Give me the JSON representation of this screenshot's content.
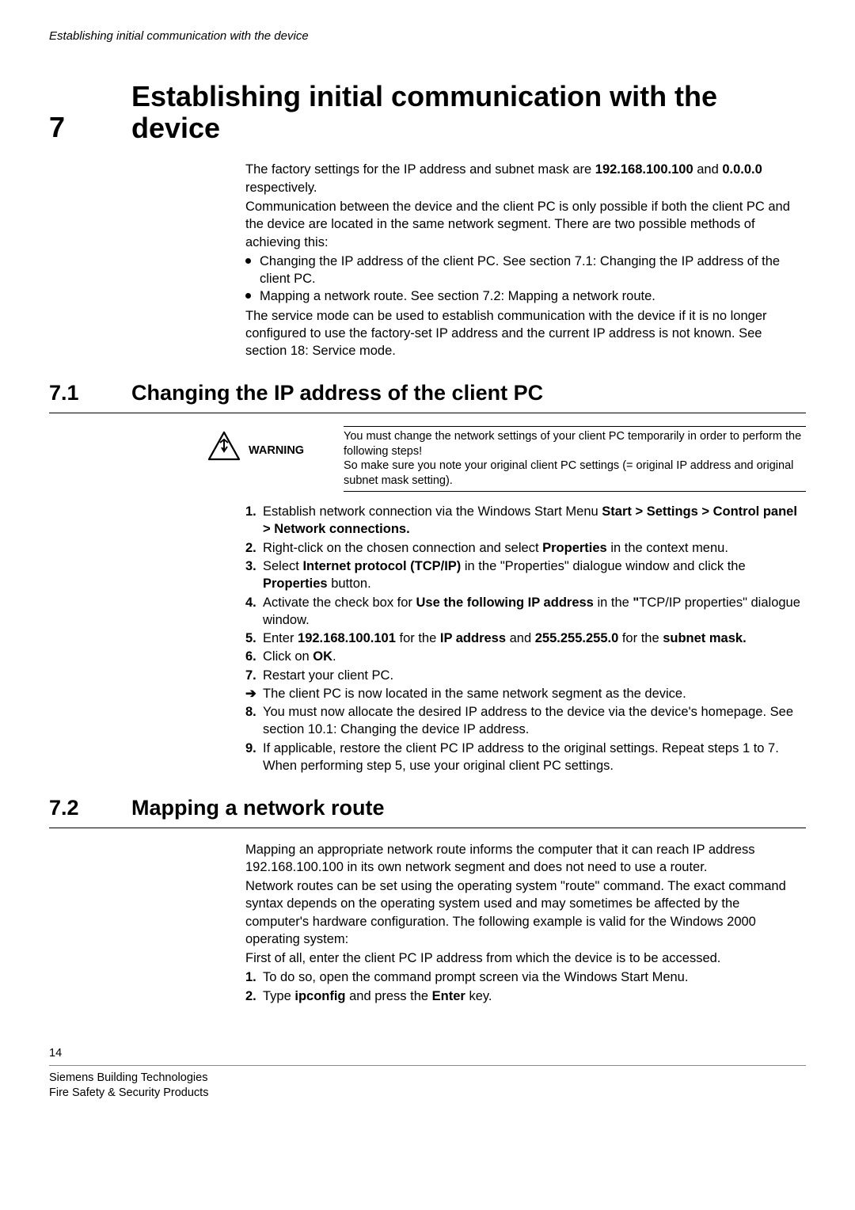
{
  "running_head": "Establishing initial communication with the device",
  "chapter": {
    "num": "7",
    "title": "Establishing initial communication with the device"
  },
  "intro": {
    "p1a": "The factory settings for the IP address and subnet mask are ",
    "p1b": "192.168.100.100",
    "p1c": " and ",
    "p1d": "0.0.0.0",
    "p1e": " respectively.",
    "p2": "Communication between the device and the client PC is only possible if both the client PC and the device are located in the same network segment. There are two possible methods of achieving this:",
    "b1": "Changing the IP address of the client PC. See section 7.1: Changing the IP address of the client PC.",
    "b2": "Mapping a network route. See section 7.2: Mapping a network route.",
    "p3": "The service mode can be used to establish communication with the device if it is no longer configured to use the factory-set IP address and the current IP address is not known. See section 18: Service mode."
  },
  "sec71": {
    "num": "7.1",
    "title": "Changing the IP address of the client PC",
    "warn_label": "WARNING",
    "warn_text": "You must change the network settings of your client PC temporarily in order to perform the following steps!\nSo make sure you note your original client PC settings (= original IP address and original subnet mask setting).",
    "s1a": "Establish network connection via the Windows Start Menu ",
    "s1b": "Start > Settings > Control panel > Network connections.",
    "s2a": "Right-click on the chosen connection and select ",
    "s2b": "Properties",
    "s2c": " in the context menu.",
    "s3a": "Select ",
    "s3b": "Internet protocol (TCP/IP)",
    "s3c": " in the \"Properties\" dialogue window and click the ",
    "s3d": "Properties",
    "s3e": " button.",
    "s4a": "Activate the check box for ",
    "s4b": "Use the following IP address",
    "s4c": " in the ",
    "s4d": "\"",
    "s4e": "TCP/IP properties\" dialogue window.",
    "s5a": "Enter ",
    "s5b": "192.168.100.101",
    "s5c": " for the ",
    "s5d": "IP address",
    "s5e": " and ",
    "s5f": "255.255.255.0",
    "s5g": " for the ",
    "s5h": "subnet mask.",
    "s6a": "Click on ",
    "s6b": "OK",
    "s6c": ".",
    "s7": "Restart your client PC.",
    "arrow": "The client PC is now located in the same network segment as the device.",
    "s8": "You must now allocate the desired IP address to the device via the device's homepage. See section 10.1: Changing the device IP address.",
    "s9": "If applicable, restore the client PC IP address to the original settings. Repeat steps 1 to 7. When performing step 5, use your original client PC settings."
  },
  "sec72": {
    "num": "7.2",
    "title": "Mapping a network route",
    "p1": "Mapping an appropriate network route informs the computer that it can reach IP address 192.168.100.100 in its own network segment and does not need to use a router.",
    "p2": "Network routes can be set using the operating system \"route\" command. The exact command syntax depends on the operating system used and may sometimes be affected by the computer's hardware configuration. The following example is valid for the Windows 2000 operating system:",
    "p3": "First of all, enter the client PC IP address from which the device is to be accessed.",
    "s1": "To do so, open the command prompt screen via the Windows Start Menu.",
    "s2a": "Type ",
    "s2b": "ipconfig",
    "s2c": " and press the ",
    "s2d": "Enter",
    "s2e": " key."
  },
  "page_number": "14",
  "footer1": "Siemens Building Technologies",
  "footer2": "Fire Safety & Security Products"
}
